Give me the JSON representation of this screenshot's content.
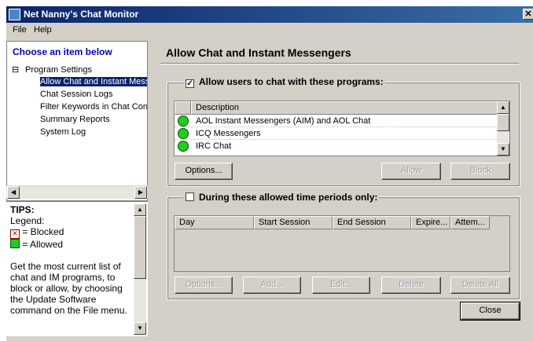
{
  "window": {
    "title": "Net Nanny's Chat Monitor",
    "close_glyph": "✕"
  },
  "menu": {
    "items": [
      "File",
      "Help"
    ]
  },
  "left": {
    "heading": "Choose an item below",
    "tree": {
      "root": "Program Settings",
      "toggle": "⊟",
      "children": [
        "Allow Chat and Instant Mess",
        "Chat Session Logs",
        "Filter Keywords in Chat Conv",
        "Summary Reports",
        "System Log"
      ]
    },
    "tips": {
      "title": "TIPS:",
      "legend": "Legend:",
      "blocked": "= Blocked",
      "allowed": "= Allowed",
      "body": "Get the most current list of chat and IM programs, to block or allow, by choosing the Update Software command on the File menu."
    }
  },
  "main": {
    "title": "Allow Chat and Instant Messengers",
    "allow_section": {
      "checkbox_label": "Allow users to chat with these programs:",
      "checked": true,
      "column": "Description",
      "rows": [
        "AOL Instant Messengers (AIM) and AOL Chat",
        "ICQ Messengers",
        "IRC Chat"
      ],
      "buttons": {
        "options": "Options...",
        "allow": "Allow",
        "block": "Block"
      }
    },
    "time_section": {
      "checkbox_label": "During these allowed time periods only:",
      "checked": false,
      "columns": [
        "Day",
        "Start Session",
        "End Session",
        "Expire...",
        "Attem..."
      ],
      "buttons": {
        "options": "Options...",
        "add": "Add...",
        "edit": "Edit...",
        "delete": "Delete",
        "delete_all": "Delete All"
      }
    },
    "close_button": "Close"
  },
  "colors": {
    "titlebar": "#0a246a",
    "face": "#d4d0c8",
    "heading": "#0000c0",
    "allowed": "#22cc22",
    "blocked": "#cc0000"
  }
}
